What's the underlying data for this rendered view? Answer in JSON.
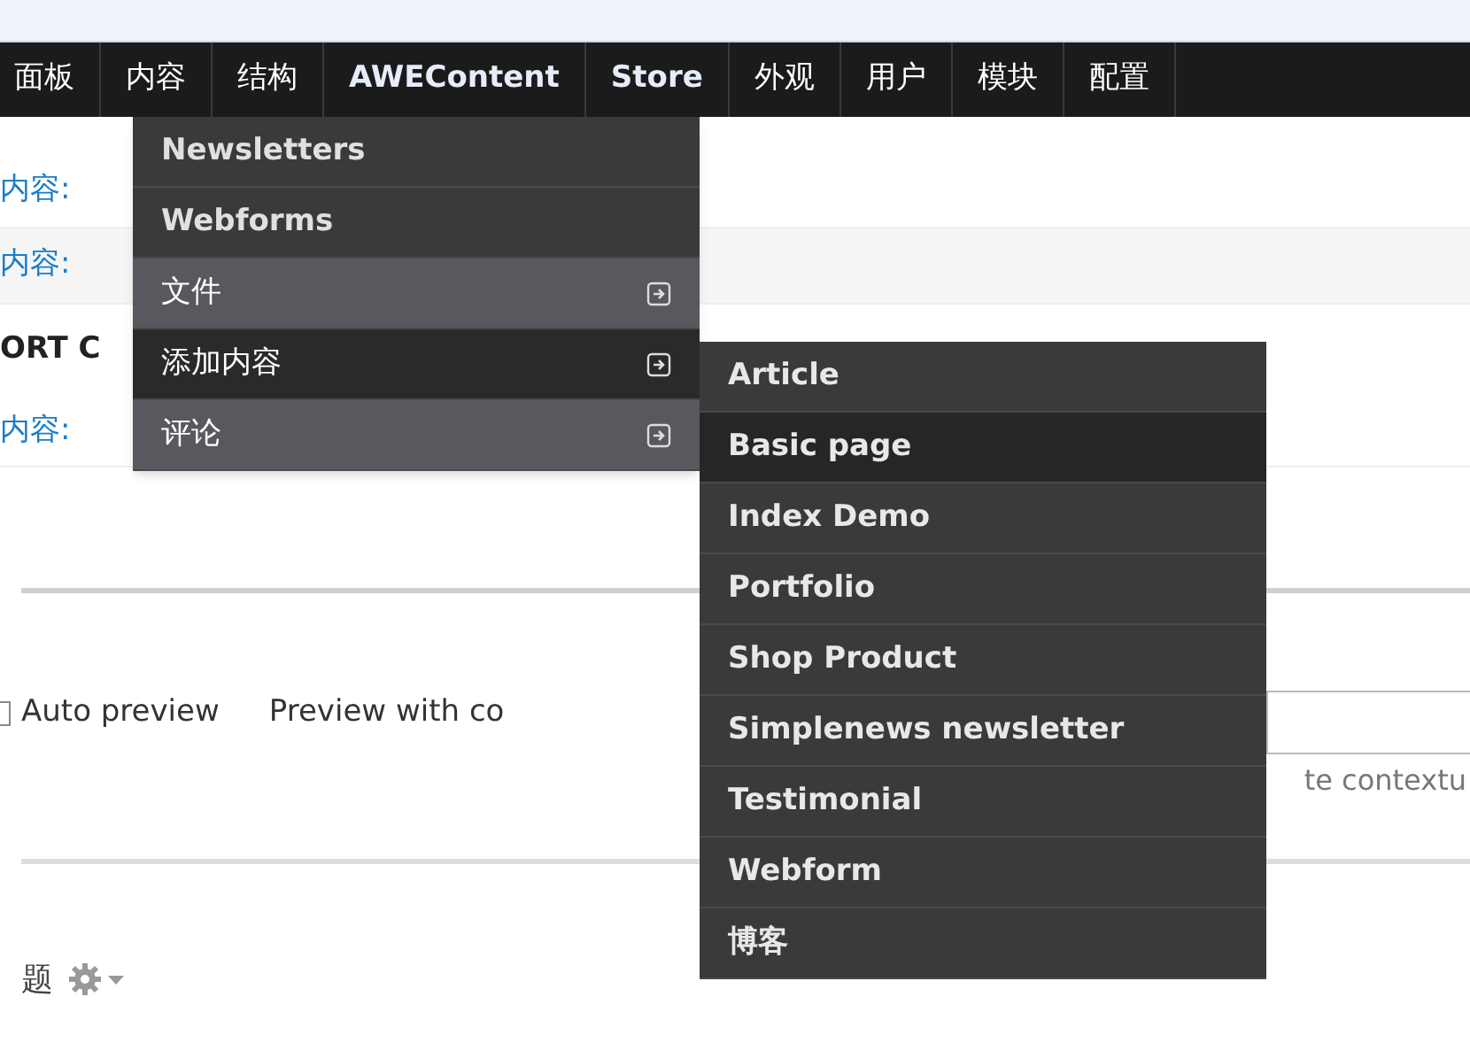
{
  "nav": [
    {
      "label": "面板",
      "bold": false
    },
    {
      "label": "内容",
      "bold": false
    },
    {
      "label": "结构",
      "bold": false
    },
    {
      "label": "AWEContent",
      "bold": true
    },
    {
      "label": "Store",
      "bold": true
    },
    {
      "label": "外观",
      "bold": false
    },
    {
      "label": "用户",
      "bold": false
    },
    {
      "label": "模块",
      "bold": false
    },
    {
      "label": "配置",
      "bold": false
    }
  ],
  "menu": [
    {
      "label": "Newsletters",
      "kind": "plain",
      "selected": false
    },
    {
      "label": "Webforms",
      "kind": "plain",
      "selected": false
    },
    {
      "label": "文件",
      "kind": "submenu",
      "selected": false
    },
    {
      "label": "添加内容",
      "kind": "submenu",
      "selected": true
    },
    {
      "label": "评论",
      "kind": "submenu",
      "selected": false
    }
  ],
  "submenu": [
    {
      "label": "Article",
      "selected": false
    },
    {
      "label": "Basic page",
      "selected": true
    },
    {
      "label": "Index Demo",
      "selected": false
    },
    {
      "label": "Portfolio",
      "selected": false
    },
    {
      "label": "Shop Product",
      "selected": false
    },
    {
      "label": "Simplenews newsletter",
      "selected": false
    },
    {
      "label": "Testimonial",
      "selected": false
    },
    {
      "label": "Webform",
      "selected": false
    },
    {
      "label": "博客",
      "selected": false
    }
  ],
  "filters": [
    "内容:",
    "内容:"
  ],
  "sort_heading": "ORT C",
  "sort_item": "内容:",
  "auto_preview": {
    "label": "Auto preview",
    "checked": false
  },
  "preview_label": "Preview with co",
  "argument_hint": "te contextu",
  "fields_heading": "题"
}
